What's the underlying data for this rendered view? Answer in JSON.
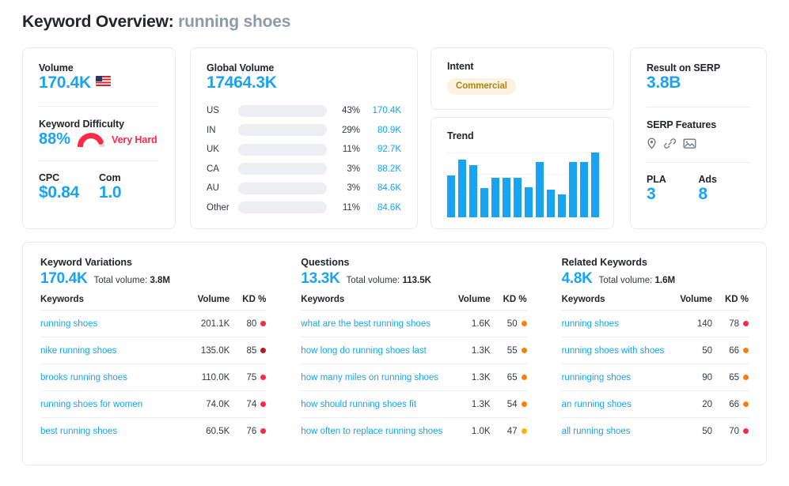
{
  "header": {
    "title_prefix": "Keyword Overview:",
    "keyword": "running shoes"
  },
  "colors": {
    "accent_blue": "#1aa3f0",
    "bar_blue": "#1aa3f0",
    "kd_red": "#fc2a47",
    "intent_badge_bg": "#fbf3e0",
    "intent_badge_text": "#a98617"
  },
  "volume_card": {
    "label": "Volume",
    "value": "170.4K",
    "flag_icon": "us-flag-icon",
    "kd_label": "Keyword Difficulty",
    "kd_value": "88%",
    "kd_rating": "Very Hard",
    "kd_gauge_percent": 88,
    "cpc_label": "CPC",
    "cpc_value": "$0.84",
    "com_label": "Com",
    "com_value": "1.0"
  },
  "global_volume_card": {
    "label": "Global Volume",
    "value": "17464.3K",
    "rows": [
      {
        "country": "US",
        "bar_percent": 51,
        "percent": "43%",
        "volume": "170.4K"
      },
      {
        "country": "IN",
        "bar_percent": 22,
        "percent": "29%",
        "volume": "80.9K"
      },
      {
        "country": "UK",
        "bar_percent": 25,
        "percent": "11%",
        "volume": "92.7K"
      },
      {
        "country": "CA",
        "bar_percent": 8,
        "percent": "3%",
        "volume": "88.2K"
      },
      {
        "country": "AU",
        "bar_percent": 8,
        "percent": "3%",
        "volume": "84.6K"
      },
      {
        "country": "Other",
        "bar_percent": 20,
        "percent": "11%",
        "volume": "84.6K"
      }
    ]
  },
  "intent_card": {
    "label": "Intent",
    "badge": "Commercial"
  },
  "trend_card": {
    "label": "Trend",
    "chart_data": {
      "type": "bar",
      "title": "Trend",
      "xlabel": "",
      "ylabel": "",
      "grid": true,
      "legend": "none",
      "ylim": [
        0,
        100
      ],
      "categories": [
        "1",
        "2",
        "3",
        "4",
        "5",
        "6",
        "7",
        "8",
        "9",
        "10",
        "11",
        "12",
        "13",
        "14"
      ],
      "values": [
        58,
        79,
        72,
        40,
        54,
        54,
        54,
        41,
        76,
        38,
        32,
        76,
        76,
        89
      ]
    }
  },
  "serp_card": {
    "result_label": "Result on SERP",
    "result_value": "3.8B",
    "features_label": "SERP Features",
    "features": [
      "map-pin-icon",
      "link-icon",
      "image-icon"
    ],
    "pla_label": "PLA",
    "pla_value": "3",
    "ads_label": "Ads",
    "ads_value": "8"
  },
  "tables": {
    "columns": [
      "Keywords",
      "Volume",
      "KD %"
    ],
    "keyword_variations": {
      "title": "Keyword Variations",
      "count": "170.4K",
      "total_label": "Total volume:",
      "total_value": "3.8M",
      "rows": [
        {
          "keyword": "running shoes",
          "volume": "201.1K",
          "kd": "80",
          "dot": "#fc2a47"
        },
        {
          "keyword": "nike running shoes",
          "volume": "135.0K",
          "kd": "85",
          "dot": "#b51a2b"
        },
        {
          "keyword": "brooks running shoes",
          "volume": "110.0K",
          "kd": "75",
          "dot": "#fc2a47"
        },
        {
          "keyword": "running shoes for women",
          "volume": "74.0K",
          "kd": "74",
          "dot": "#fc2a47"
        },
        {
          "keyword": "best running shoes",
          "volume": "60.5K",
          "kd": "76",
          "dot": "#fc2a47"
        }
      ]
    },
    "questions": {
      "title": "Questions",
      "count": "13.3K",
      "total_label": "Total volume:",
      "total_value": "113.5K",
      "rows": [
        {
          "keyword": "what are the best running shoes",
          "volume": "1.6K",
          "kd": "50",
          "dot": "#f98007"
        },
        {
          "keyword": "how long do running shoes last",
          "volume": "1.3K",
          "kd": "55",
          "dot": "#f98007"
        },
        {
          "keyword": "how many miles on running shoes",
          "volume": "1.3K",
          "kd": "65",
          "dot": "#f98007"
        },
        {
          "keyword": "how should running shoes fit",
          "volume": "1.3K",
          "kd": "54",
          "dot": "#f98007"
        },
        {
          "keyword": "how often to replace running shoes",
          "volume": "1.0K",
          "kd": "47",
          "dot": "#ffb400"
        }
      ]
    },
    "related_keywords": {
      "title": "Related Keywords",
      "count": "4.8K",
      "total_label": "Total volume:",
      "total_value": "1.6M",
      "rows": [
        {
          "keyword": "running shoes",
          "volume": "140",
          "kd": "78",
          "dot": "#fc2a47"
        },
        {
          "keyword": "running shoes with shoes",
          "volume": "50",
          "kd": "66",
          "dot": "#f98007"
        },
        {
          "keyword": "runninging shoes",
          "volume": "90",
          "kd": "65",
          "dot": "#f98007"
        },
        {
          "keyword": "an running shoes",
          "volume": "20",
          "kd": "66",
          "dot": "#f98007"
        },
        {
          "keyword": "all running shoes",
          "volume": "50",
          "kd": "70",
          "dot": "#fc2a47"
        }
      ]
    }
  }
}
